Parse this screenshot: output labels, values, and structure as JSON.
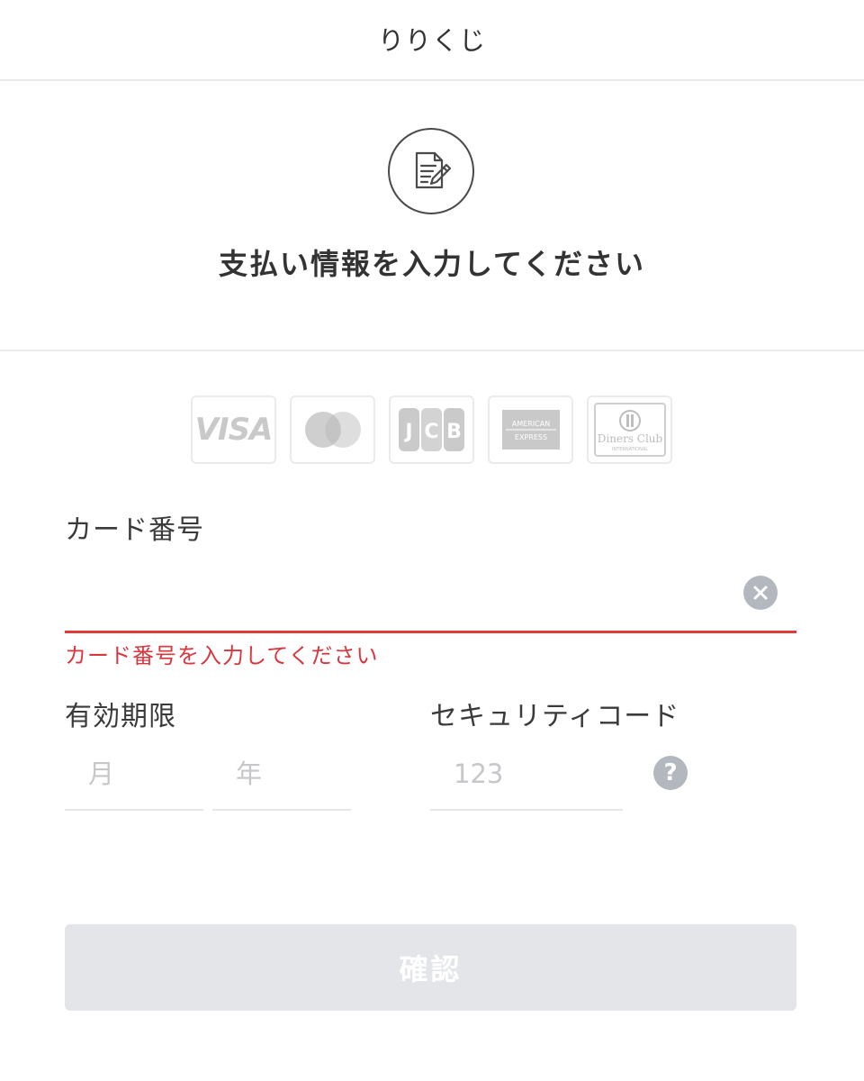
{
  "header": {
    "title": "りりくじ"
  },
  "main": {
    "icon": "document-edit-icon",
    "heading": "支払い情報を入力してください"
  },
  "card_brands": [
    {
      "name": "VISA",
      "icon": "visa-logo"
    },
    {
      "name": "Mastercard",
      "icon": "mastercard-logo"
    },
    {
      "name": "JCB",
      "icon": "jcb-logo"
    },
    {
      "name": "AMERICAN EXPRESS",
      "icon": "amex-logo"
    },
    {
      "name": "Diners Club INTERNATIONAL",
      "icon": "diners-club-logo"
    }
  ],
  "card_number": {
    "label": "カード番号",
    "value": "",
    "error": "カード番号を入力してください"
  },
  "expiry": {
    "label": "有効期限",
    "month_placeholder": "月",
    "year_placeholder": "年"
  },
  "security_code": {
    "label": "セキュリティコード",
    "placeholder": "123",
    "help_symbol": "?"
  },
  "confirm_button": {
    "label": "確認"
  },
  "colors": {
    "error": "#d9363e",
    "disabled_button_bg": "#e3e5e8",
    "icon_gray": "#b3b8bf"
  }
}
